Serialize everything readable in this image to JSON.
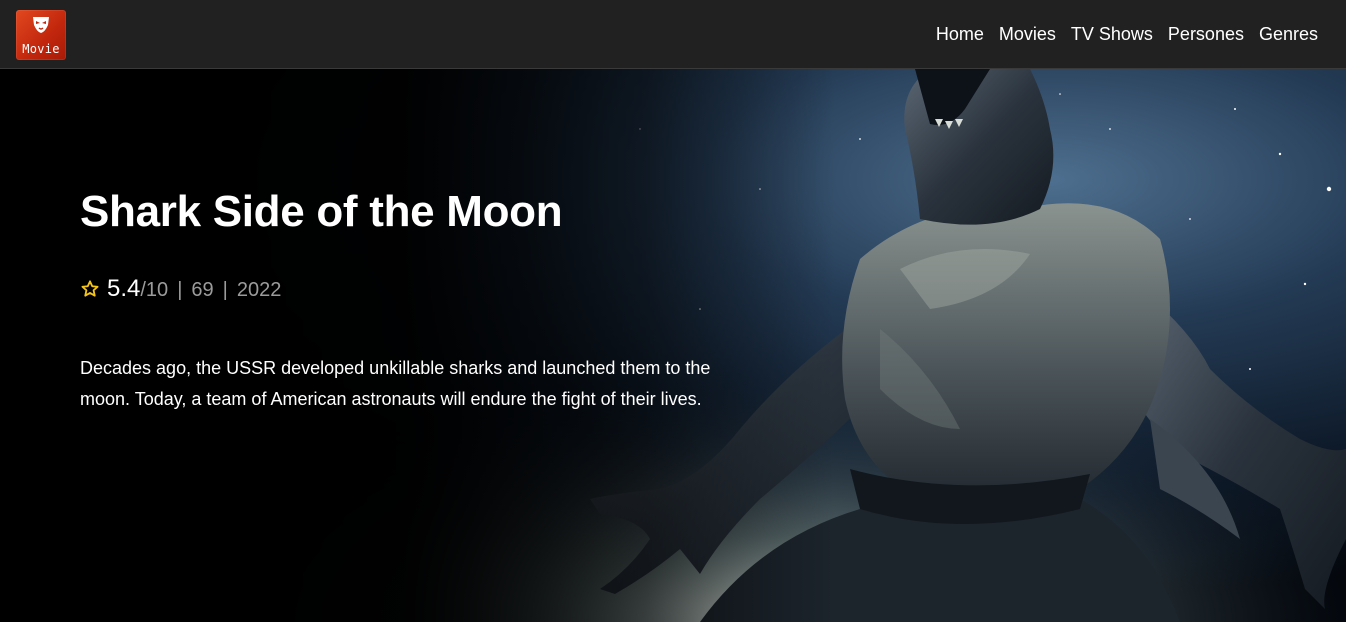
{
  "logo": {
    "text": "Movie",
    "icon": "mask-icon",
    "color": "#d9361a"
  },
  "nav": {
    "items": [
      {
        "label": "Home"
      },
      {
        "label": "Movies"
      },
      {
        "label": "TV Shows"
      },
      {
        "label": "Persones"
      },
      {
        "label": "Genres"
      }
    ]
  },
  "movie": {
    "title": "Shark Side of the Moon",
    "rating": "5.4",
    "rating_max": "/10",
    "votes": "69",
    "year": "2022",
    "overview": "Decades ago, the USSR developed unkillable sharks and launched them to the moon. Today, a team of American astronauts will endure the fight of their lives.",
    "star_icon": "star-outline-icon",
    "star_color": "#f5c518"
  },
  "colors": {
    "navbar_bg": "#212121",
    "text_primary": "#ffffff",
    "text_secondary": "#9b9b9b"
  }
}
